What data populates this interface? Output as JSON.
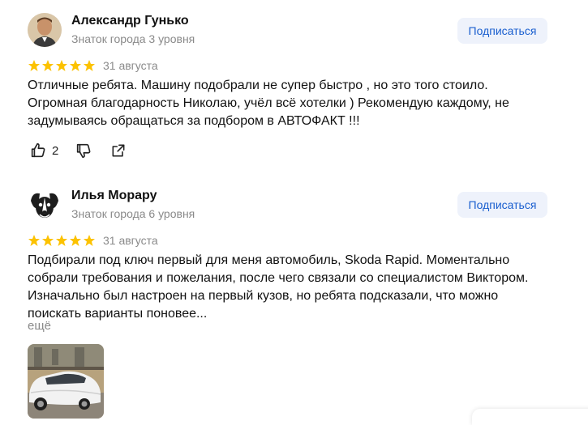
{
  "reviews": [
    {
      "author": "Александр Гунько",
      "level": "Знаток города 3 уровня",
      "subscribe_label": "Подписаться",
      "rating": 5,
      "date": "31 августа",
      "text": "Отличные ребята. Машину подобрали не супер быстро , но это того стоило. Огромная благодарность Николаю, учёл всё хотелки ) Рекомендую каждому, не задумываясь обращаться за подбором в АВТОФАКТ !!!",
      "likes": "2"
    },
    {
      "author": "Илья Морару",
      "level": "Знаток города 6 уровня",
      "subscribe_label": "Подписаться",
      "rating": 5,
      "date": "31 августа",
      "text": "Подбирали под ключ первый для меня автомобиль, Skoda Rapid. Моментально собрали требования и пожелания, после чего связали со специалистом Виктором. Изначально был настроен на первый кузов, но ребята подсказали, что можно поискать варианты поновее...",
      "more_label": "ещё"
    }
  ],
  "colors": {
    "star": "#fcc200",
    "subscribe_bg": "#eef2fb",
    "subscribe_text": "#1a5fcf",
    "muted": "#8a8a8a"
  }
}
